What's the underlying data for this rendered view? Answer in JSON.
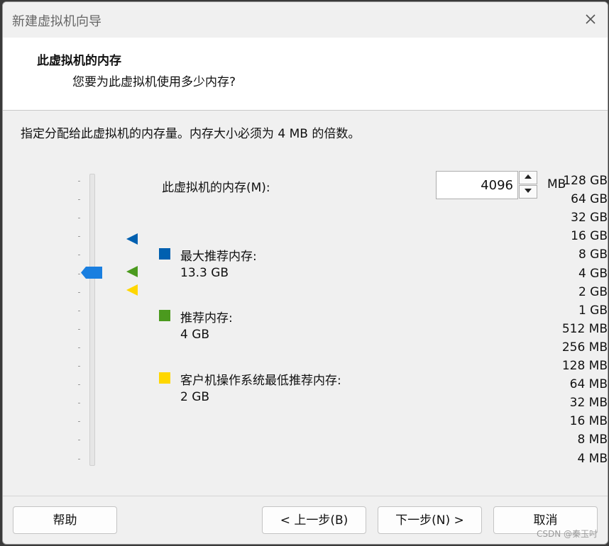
{
  "window": {
    "title": "新建虚拟机向导"
  },
  "header": {
    "title": "此虚拟机的内存",
    "subtitle": "您要为此虚拟机使用多少内存?"
  },
  "instruction": "指定分配给此虚拟机的内存量。内存大小必须为 4 MB 的倍数。",
  "memory_scale": [
    "128 GB",
    "64 GB",
    "32 GB",
    "16 GB",
    "8 GB",
    "4 GB",
    "2 GB",
    "1 GB",
    "512 MB",
    "256 MB",
    "128 MB",
    "64 MB",
    "32 MB",
    "16 MB",
    "8 MB",
    "4 MB"
  ],
  "slider": {
    "selected": "4 GB"
  },
  "memory_field": {
    "label": "此虚拟机的内存(M):",
    "value": "4096",
    "unit": "MB"
  },
  "legend": {
    "max": {
      "label": "最大推荐内存:",
      "value": "13.3 GB",
      "color": "#0060b0"
    },
    "recommended": {
      "label": "推荐内存:",
      "value": "4 GB",
      "color": "#4b9a1e"
    },
    "min": {
      "label": "客户机操作系统最低推荐内存:",
      "value": "2 GB",
      "color": "#ffd700"
    }
  },
  "buttons": {
    "help": "帮助",
    "back": "< 上一步(B)",
    "next": "下一步(N) >",
    "cancel": "取消"
  },
  "watermark": "CSDN @秦玉吋"
}
